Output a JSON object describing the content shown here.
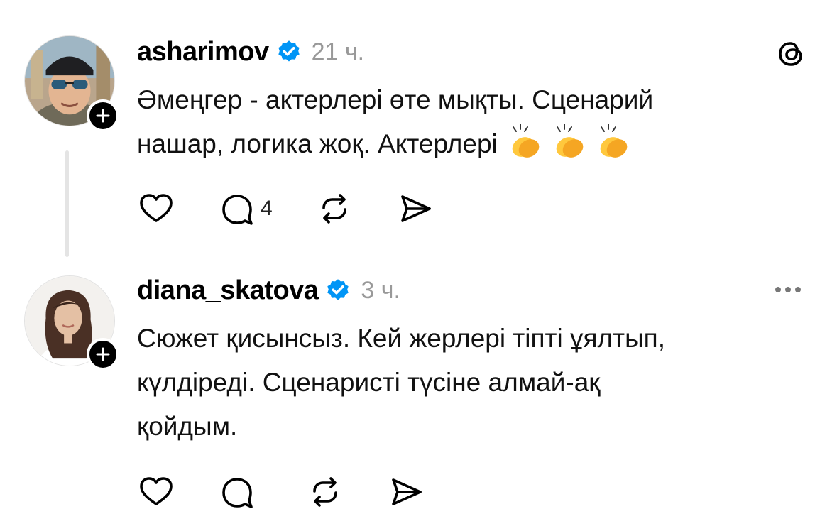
{
  "posts": [
    {
      "username": "asharimov",
      "time": "21 ч.",
      "text": "Әмеңгер - актерлері өте мықты. Сценарий\nнашар, логика жоқ. Актерлері",
      "emoji_count": 3,
      "emoji_name": "clapping-hands",
      "reply_count": "4"
    },
    {
      "username": "diana_skatova",
      "time": "3 ч.",
      "text": "Сюжет қисынсыз. Кей жерлері тіпті ұялтып,\nкүлдіреді. Сценаристі түсіне алмай-ақ\nқойдым.",
      "reply_count": ""
    }
  ],
  "icons": {
    "like": "heart-icon",
    "reply": "comment-bubble-icon",
    "repost": "repost-icon",
    "share": "send-icon",
    "verified": "verified-badge-icon",
    "follow": "plus-icon",
    "app_logo": "threads-logo-icon",
    "more": "more-horizontal-icon"
  },
  "colors": {
    "verified_blue": "#0095f6",
    "time_gray": "#999999",
    "thread_line": "#e4e4e4"
  }
}
